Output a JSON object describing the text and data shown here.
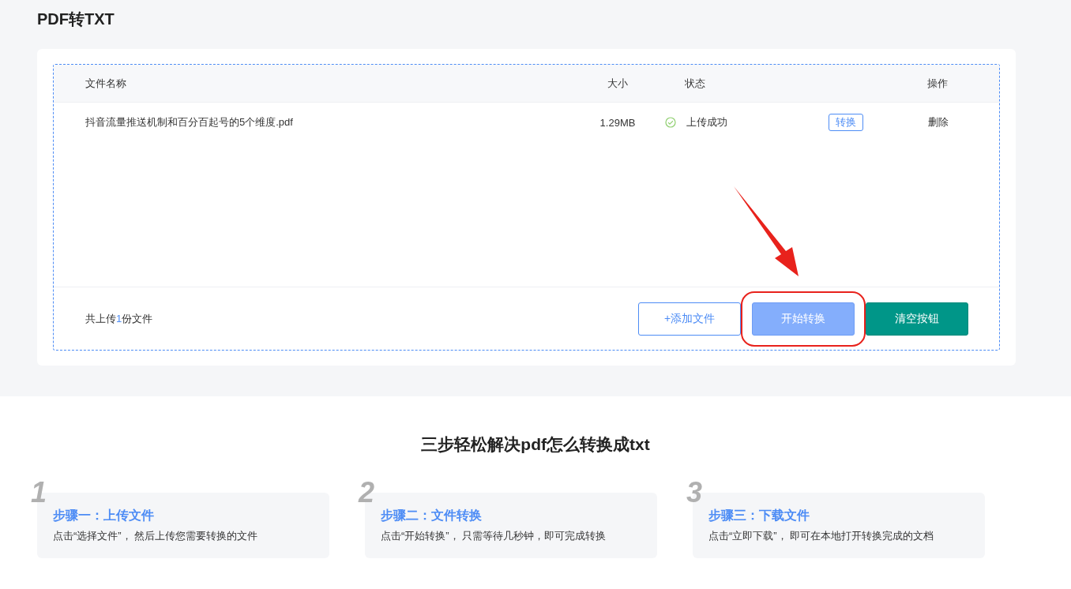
{
  "title": "PDF转TXT",
  "table": {
    "columns": [
      "文件名称",
      "大小",
      "状态",
      "操作"
    ],
    "rows": [
      {
        "name": "抖音流量推送机制和百分百起号的5个维度.pdf",
        "size": "1.29MB",
        "status": "上传成功",
        "kind": "success",
        "convert": "转换",
        "delete": "删除"
      }
    ]
  },
  "summary": {
    "before": "共上传",
    "count": "1",
    "after": "份文件"
  },
  "buttons": [
    {
      "label": "+添加文件",
      "kind": "outline",
      "highlighted": false
    },
    {
      "label": "开始转换",
      "kind": "primary",
      "highlighted": true
    },
    {
      "label": "清空按钮",
      "kind": "teal",
      "highlighted": false
    }
  ],
  "steps_heading": "三步轻松解决pdf怎么转换成txt",
  "steps": [
    {
      "number": "1",
      "title": "步骤一：上传文件",
      "description": "点击“选择文件”， 然后上传您需要转换的文件"
    },
    {
      "number": "2",
      "title": "步骤二：文件转换",
      "description": "点击“开始转换”， 只需等待几秒钟，即可完成转换"
    },
    {
      "number": "3",
      "title": "步骤三：下载文件",
      "description": "点击“立即下载”， 即可在本地打开转换完成的文档"
    }
  ]
}
